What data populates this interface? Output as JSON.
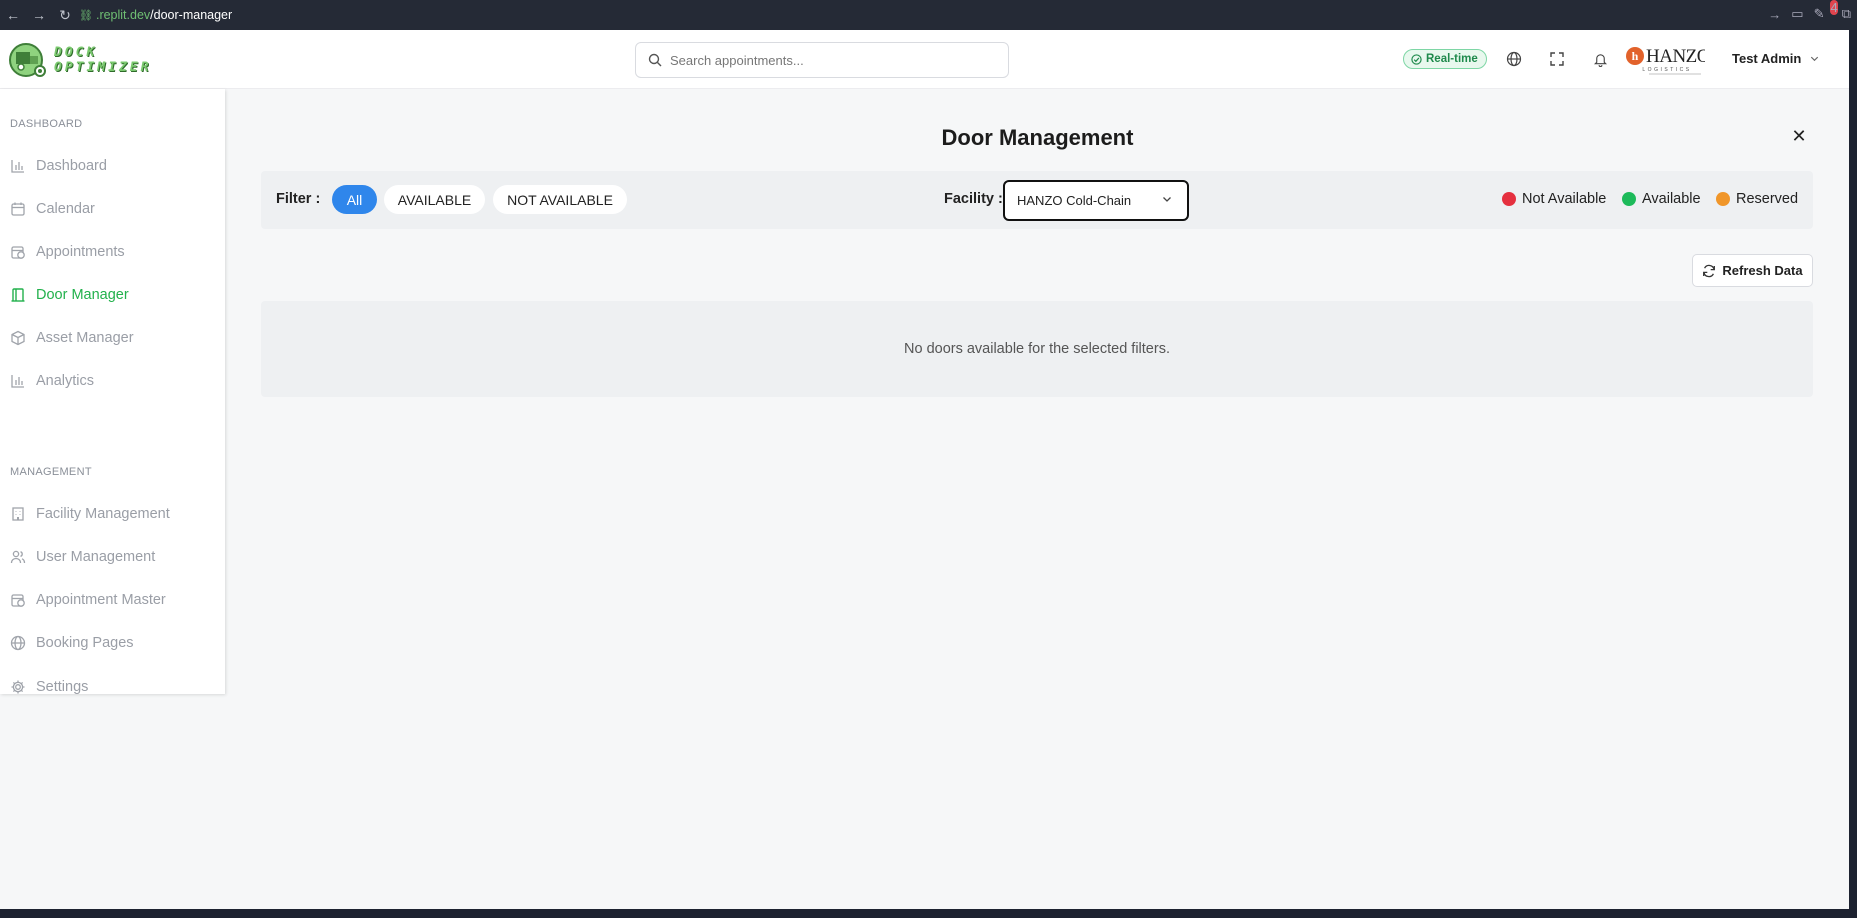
{
  "browser": {
    "url_host": ".replit.dev",
    "url_path": "/door-manager",
    "badge_count": "4"
  },
  "header": {
    "logo_line1": "DOCK",
    "logo_line2": "OPTIMIZER",
    "search_placeholder": "Search appointments...",
    "realtime_label": "Real-time",
    "brand_name": "HANZO",
    "brand_sub": "LOGISTICS",
    "user_name": "Test Admin"
  },
  "sidebar": {
    "dashboard_section": "DASHBOARD",
    "management_section": "MANAGEMENT",
    "items": [
      {
        "label": "Dashboard",
        "icon": "bar-chart-icon"
      },
      {
        "label": "Calendar",
        "icon": "calendar-icon"
      },
      {
        "label": "Appointments",
        "icon": "calendar-clock-icon"
      },
      {
        "label": "Door Manager",
        "icon": "door-icon",
        "active": true
      },
      {
        "label": "Asset Manager",
        "icon": "box-icon"
      },
      {
        "label": "Analytics",
        "icon": "bar-chart-icon"
      },
      {
        "label": "Facility Management",
        "icon": "building-icon"
      },
      {
        "label": "User Management",
        "icon": "users-icon"
      },
      {
        "label": "Appointment Master",
        "icon": "calendar-clock-icon"
      },
      {
        "label": "Booking Pages",
        "icon": "globe-icon"
      },
      {
        "label": "Settings",
        "icon": "gear-icon"
      }
    ]
  },
  "main": {
    "title": "Door Management",
    "filter_label": "Filter :",
    "filters": [
      "All",
      "AVAILABLE",
      "NOT AVAILABLE"
    ],
    "active_filter": "All",
    "facility_label": "Facility :",
    "facility_value": "HANZO Cold-Chain",
    "legend": [
      {
        "label": "Not Available",
        "color": "#e5303f"
      },
      {
        "label": "Available",
        "color": "#1dba5a"
      },
      {
        "label": "Reserved",
        "color": "#f0962a"
      }
    ],
    "refresh_label": "Refresh Data",
    "empty_message": "No doors available for the selected filters."
  },
  "colors": {
    "accent": "#2f86eb",
    "active_nav": "#22b14c"
  }
}
